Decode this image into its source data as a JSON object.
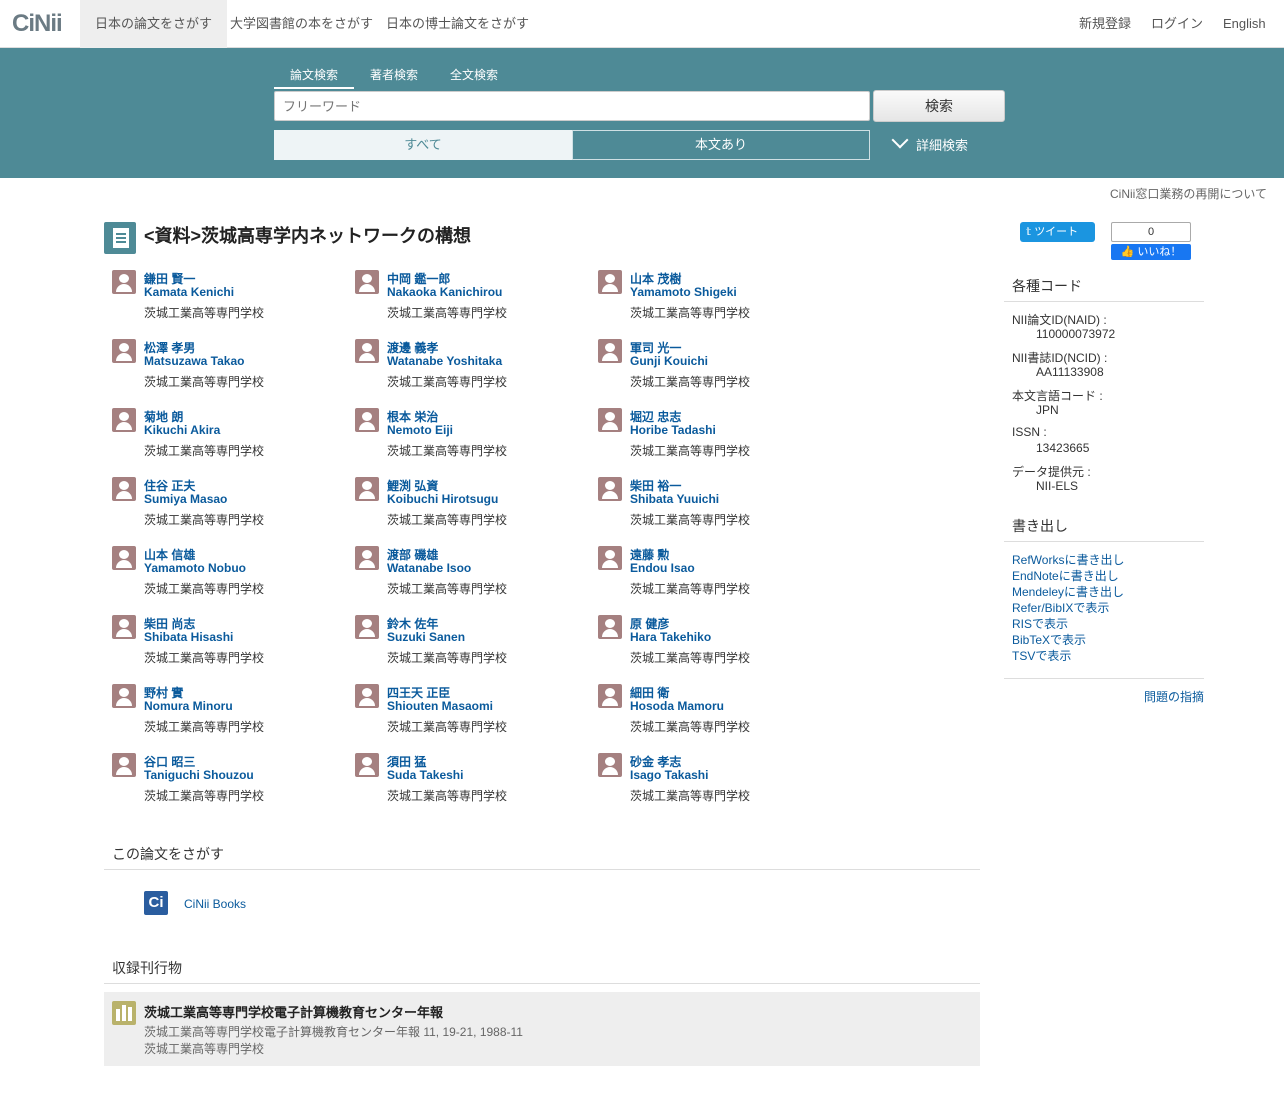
{
  "header": {
    "logo": "CiNii",
    "tabs": [
      "日本の論文をさがす",
      "大学図書館の本をさがす",
      "日本の博士論文をさがす"
    ],
    "right": [
      "新規登録",
      "ログイン",
      "English"
    ]
  },
  "search": {
    "tabs": [
      "論文検索",
      "著者検索",
      "全文検索"
    ],
    "placeholder": "フリーワード",
    "button": "検索",
    "filter_all": "すべて",
    "filter_body": "本文あり",
    "advanced": "詳細検索"
  },
  "notice": "CiNii窓口業務の再開について",
  "article": {
    "title": "<資料>茨城高専学内ネットワークの構想"
  },
  "social": {
    "tweet": "ツイート",
    "like_count": "0",
    "like": "いいね！"
  },
  "authors": [
    {
      "jp": "鎌田 賢一",
      "en": "Kamata Kenichi",
      "aff": "茨城工業高等専門学校"
    },
    {
      "jp": "中岡 鑑一郎",
      "en": "Nakaoka Kanichirou",
      "aff": "茨城工業高等専門学校"
    },
    {
      "jp": "山本 茂樹",
      "en": "Yamamoto Shigeki",
      "aff": "茨城工業高等専門学校"
    },
    {
      "jp": "松澤 孝男",
      "en": "Matsuzawa Takao",
      "aff": "茨城工業高等専門学校"
    },
    {
      "jp": "渡邊 義孝",
      "en": "Watanabe Yoshitaka",
      "aff": "茨城工業高等専門学校"
    },
    {
      "jp": "軍司 光一",
      "en": "Gunji Kouichi",
      "aff": "茨城工業高等専門学校"
    },
    {
      "jp": "菊地 朗",
      "en": "Kikuchi Akira",
      "aff": "茨城工業高等専門学校"
    },
    {
      "jp": "根本 栄治",
      "en": "Nemoto Eiji",
      "aff": "茨城工業高等専門学校"
    },
    {
      "jp": "堀辺 忠志",
      "en": "Horibe Tadashi",
      "aff": "茨城工業高等専門学校"
    },
    {
      "jp": "住谷 正夫",
      "en": "Sumiya Masao",
      "aff": "茨城工業高等専門学校"
    },
    {
      "jp": "鯉渕 弘資",
      "en": "Koibuchi Hirotsugu",
      "aff": "茨城工業高等専門学校"
    },
    {
      "jp": "柴田 裕一",
      "en": "Shibata Yuuichi",
      "aff": "茨城工業高等専門学校"
    },
    {
      "jp": "山本 信雄",
      "en": "Yamamoto Nobuo",
      "aff": "茨城工業高等専門学校"
    },
    {
      "jp": "渡部 磯雄",
      "en": "Watanabe Isoo",
      "aff": "茨城工業高等専門学校"
    },
    {
      "jp": "遠藤 勲",
      "en": "Endou Isao",
      "aff": "茨城工業高等専門学校"
    },
    {
      "jp": "柴田 尚志",
      "en": "Shibata Hisashi",
      "aff": "茨城工業高等専門学校"
    },
    {
      "jp": "鈴木 佐年",
      "en": "Suzuki Sanen",
      "aff": "茨城工業高等専門学校"
    },
    {
      "jp": "原 健彦",
      "en": "Hara Takehiko",
      "aff": "茨城工業高等専門学校"
    },
    {
      "jp": "野村 實",
      "en": "Nomura Minoru",
      "aff": "茨城工業高等専門学校"
    },
    {
      "jp": "四王天 正臣",
      "en": "Shiouten Masaomi",
      "aff": "茨城工業高等専門学校"
    },
    {
      "jp": "細田 衛",
      "en": "Hosoda Mamoru",
      "aff": "茨城工業高等専門学校"
    },
    {
      "jp": "谷口 昭三",
      "en": "Taniguchi Shouzou",
      "aff": "茨城工業高等専門学校"
    },
    {
      "jp": "須田 猛",
      "en": "Suda Takeshi",
      "aff": "茨城工業高等専門学校"
    },
    {
      "jp": "砂金 孝志",
      "en": "Isago Takashi",
      "aff": "茨城工業高等専門学校"
    }
  ],
  "find": {
    "heading": "この論文をさがす",
    "link": "CiNii Books",
    "icon_text": "Ci"
  },
  "journal": {
    "heading": "収録刊行物",
    "title": "茨城工業高等専門学校電子計算機教育センター年報",
    "citation": "茨城工業高等専門学校電子計算機教育センター年報 11, 19-21, 1988-11",
    "publisher": "茨城工業高等専門学校"
  },
  "codes": {
    "heading": "各種コード",
    "items": [
      {
        "label": "NII論文ID(NAID) :",
        "value": "110000073972",
        "link": false
      },
      {
        "label": "NII書誌ID(NCID) :",
        "value": "AA11133908",
        "link": true
      },
      {
        "label": "本文言語コード :",
        "value": "JPN",
        "link": false
      },
      {
        "label": "ISSN :",
        "value": "13423665",
        "link": false
      },
      {
        "label": "データ提供元 :",
        "value": "NII-ELS",
        "link": false
      }
    ]
  },
  "export": {
    "heading": "書き出し",
    "links": [
      "RefWorksに書き出し",
      "EndNoteに書き出し",
      "Mendeleyに書き出し",
      "Refer/BibIXで表示",
      "RISで表示",
      "BibTeXで表示",
      "TSVで表示"
    ],
    "report": "問題の指摘"
  },
  "colors": {
    "band": "#4e8a96",
    "link": "#0a5a9c",
    "avatar": "#a58080",
    "journal_icon": "#b9b26b"
  }
}
